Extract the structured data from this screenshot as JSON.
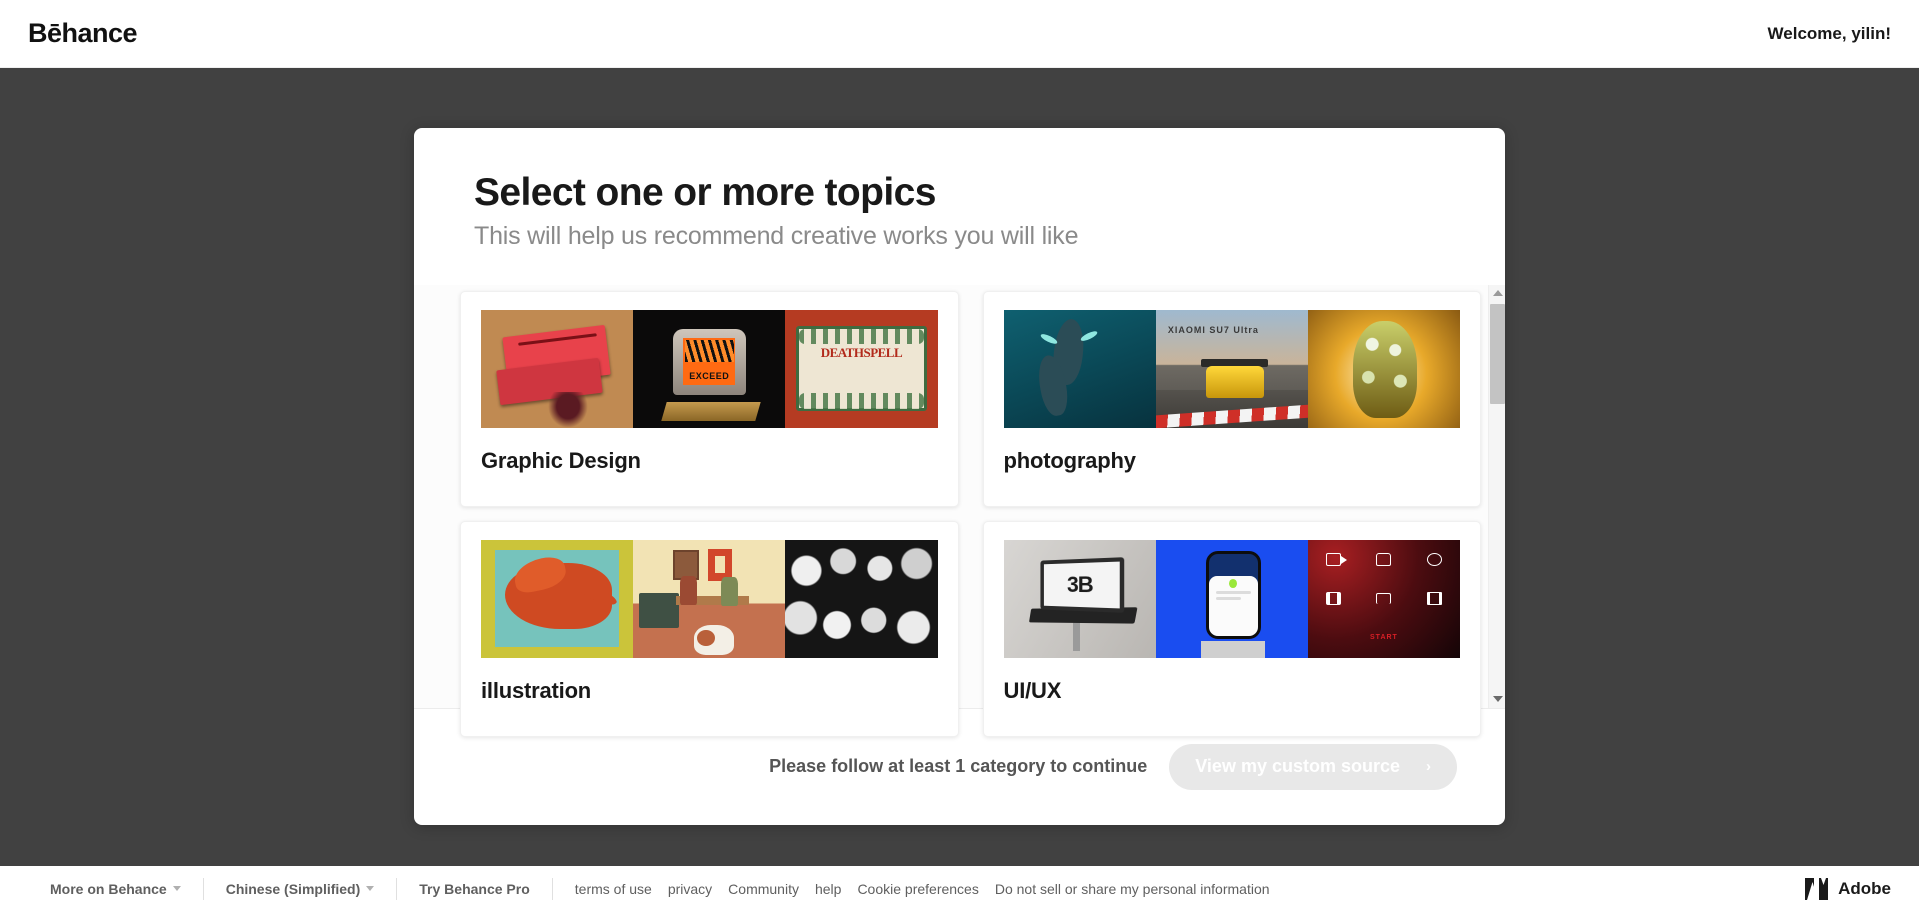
{
  "header": {
    "logo": "Bēhance",
    "welcome": "Welcome, yilin!"
  },
  "modal": {
    "title": "Select one or more topics",
    "subtitle": "This will help us recommend creative works you will like",
    "topics": [
      {
        "label": "Graphic Design",
        "thumbnails": [
          "pizza-boxes-photo",
          "exceed-crt-monitor-photo",
          "deathspell-poster-artwork"
        ]
      },
      {
        "label": "photography",
        "thumbnails": [
          "whales-underwater-photo",
          "xiaomi-su7-race-car-photo",
          "golden-floral-figure-photo"
        ],
        "thumb_text": "XIAOMI SU7 Ultra"
      },
      {
        "label": "illustration",
        "thumbnails": [
          "red-dragon-manuscript-illustration",
          "kitchen-scene-illustration",
          "black-and-white-crowd-illustration"
        ]
      },
      {
        "label": "UI/UX",
        "thumbnails": [
          "laptop-3b-mockup",
          "phone-app-mockup",
          "red-icon-grid-artwork"
        ],
        "thumb_text": "3B",
        "thumb_text2": "START"
      }
    ],
    "cta": {
      "note": "Please follow at least 1 category to continue",
      "button_label": "View my custom source",
      "button_chevron": "›",
      "button_enabled": false
    }
  },
  "scrollbar": {
    "up_arrow": "scroll-up",
    "down_arrow": "scroll-down"
  },
  "footer": {
    "more_on_behance": "More on Behance",
    "language": "Chinese (Simplified)",
    "try_pro": "Try Behance Pro",
    "links": [
      "terms of use",
      "privacy",
      "Community",
      "help",
      "Cookie preferences",
      "Do not sell or share my personal information"
    ],
    "adobe": "Adobe"
  },
  "colors": {
    "stage_background": "#414141",
    "accent_text": "#191919",
    "muted_text": "#8a8a8a",
    "disabled_button": "#e8e8e8"
  }
}
